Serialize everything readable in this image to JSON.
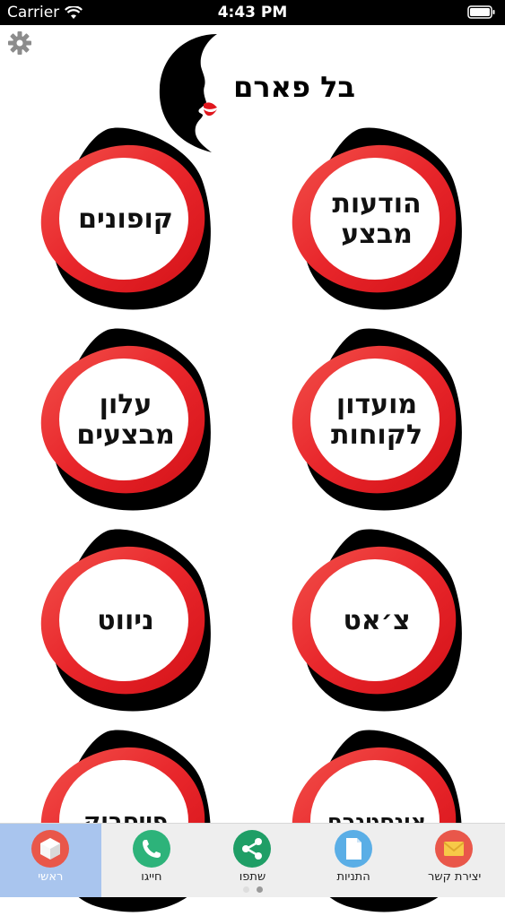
{
  "status_bar": {
    "carrier": "Carrier",
    "time": "4:43 PM"
  },
  "header": {
    "logo_text": "בל פארם",
    "settings_icon": "gear-icon"
  },
  "tiles": [
    {
      "label": "הודעות\nמבצע"
    },
    {
      "label": "קופונים"
    },
    {
      "label": "מועדון\nלקוחות"
    },
    {
      "label": "עלון\nמבצעים"
    },
    {
      "label": "צ׳אט"
    },
    {
      "label": "ניווט"
    },
    {
      "label": "אינסטגרם"
    },
    {
      "label": "פייסבוק"
    }
  ],
  "tab_bar": {
    "tabs": [
      {
        "label": "ראשי",
        "icon": "home-cube-icon",
        "active": true
      },
      {
        "label": "חייגו",
        "icon": "phone-icon",
        "active": false
      },
      {
        "label": "שתפו",
        "icon": "share-icon",
        "active": false
      },
      {
        "label": "התניות",
        "icon": "document-icon",
        "active": false
      },
      {
        "label": "יצירת קשר",
        "icon": "mail-icon",
        "active": false
      }
    ],
    "page_dots": 2,
    "active_dot": 1
  },
  "colors": {
    "tile_red": "#e8262b",
    "tile_black": "#000000",
    "tab_active": "#a9c5ee"
  }
}
